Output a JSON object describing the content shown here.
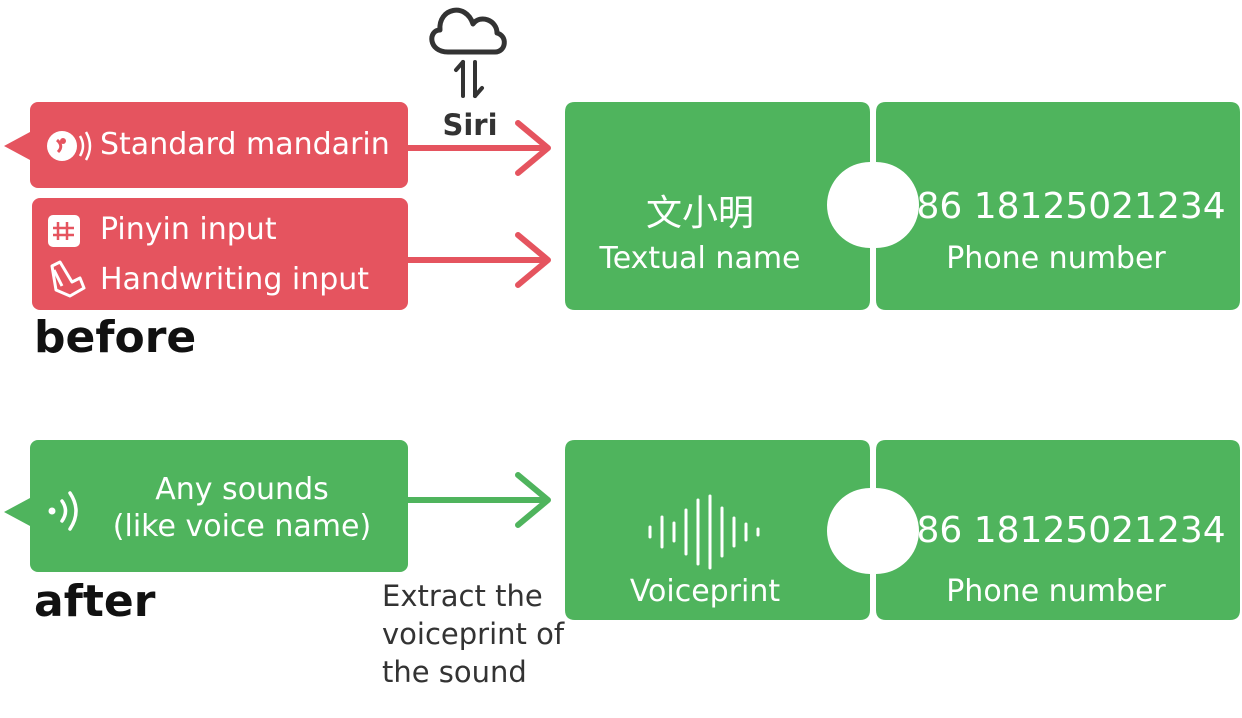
{
  "colors": {
    "red": "#e5545f",
    "green": "#4fb45d",
    "dark": "#333333"
  },
  "before": {
    "caption": "before",
    "siri_label": "Siri",
    "inputs": [
      {
        "icon": "speech-icon",
        "label": "Standard mandarin"
      },
      {
        "icon": "grid-hash-icon",
        "label": "Pinyin input"
      },
      {
        "icon": "hand-writing-icon",
        "label": "Handwriting input"
      }
    ],
    "puzzle_left": {
      "main": "文小明",
      "sub": "Textual name"
    },
    "puzzle_right": {
      "main": "+86 18125021234",
      "sub": "Phone number"
    }
  },
  "after": {
    "caption": "after",
    "input": {
      "line1": "Any sounds",
      "line2": "(like voice name)"
    },
    "note_lines": [
      "Extract the",
      "voiceprint of",
      "the sound"
    ],
    "puzzle_left": {
      "sub": "Voiceprint"
    },
    "puzzle_right": {
      "main": "+86 18125021234",
      "sub": "Phone number"
    }
  }
}
